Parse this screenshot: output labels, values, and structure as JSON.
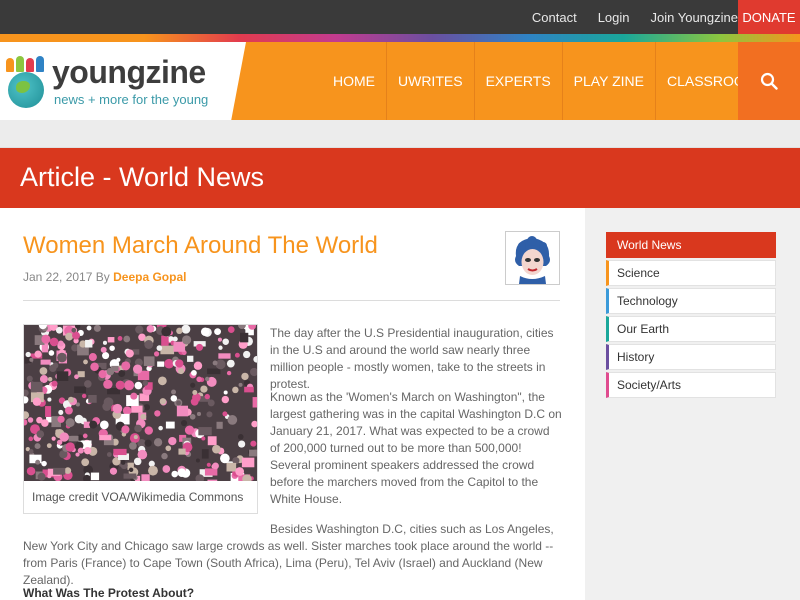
{
  "top_links": [
    "Contact",
    "Login",
    "Join Youngzine"
  ],
  "donate_label": "DONATE",
  "logo": {
    "word": "youngzine",
    "tagline": "news + more for the young"
  },
  "nav": [
    "HOME",
    "UWRITES",
    "EXPERTS",
    "PLAY ZINE",
    "CLASSROOM"
  ],
  "banner_title": "Article - World News",
  "article": {
    "title": "Women March Around The World",
    "date": "Jan 22, 2017",
    "by": "By",
    "author": "Deepa Gopal",
    "caption": "Image credit VOA/Wikimedia Commons",
    "p1": "The day after the U.S Presidential inauguration, cities in the U.S and around the world saw nearly three million people - mostly women, take to the streets in protest.",
    "p2": "Known as the 'Women's March on Washington\", the largest gathering was in the capital Washington D.C on January 21, 2017. What was expected to be a crowd of 200,000 turned out to be more than 500,000! Several prominent speakers addressed the crowd before the marchers moved from the Capitol to the White House.",
    "p3": "Besides Washington D.C, cities such as Los Angeles, New York City and Chicago saw large crowds as well. Sister marches took place around the world -- from Paris (France) to Cape Town (South Africa), Lima (Peru), Tel Aviv (Israel) and Auckland (New Zealand).",
    "subhead": "What Was The Protest About?"
  },
  "sidebar": [
    {
      "label": "World News",
      "color": "#d9381e"
    },
    {
      "label": "Science",
      "color": "#f7941d"
    },
    {
      "label": "Technology",
      "color": "#3b9ad9"
    },
    {
      "label": "Our Earth",
      "color": "#1aa79a"
    },
    {
      "label": "History",
      "color": "#6b4fa0"
    },
    {
      "label": "Society/Arts",
      "color": "#e04c8f"
    }
  ],
  "colors": {
    "accent": "#f7941d",
    "banner": "#d9381e",
    "topbar": "#3a3a3a"
  }
}
